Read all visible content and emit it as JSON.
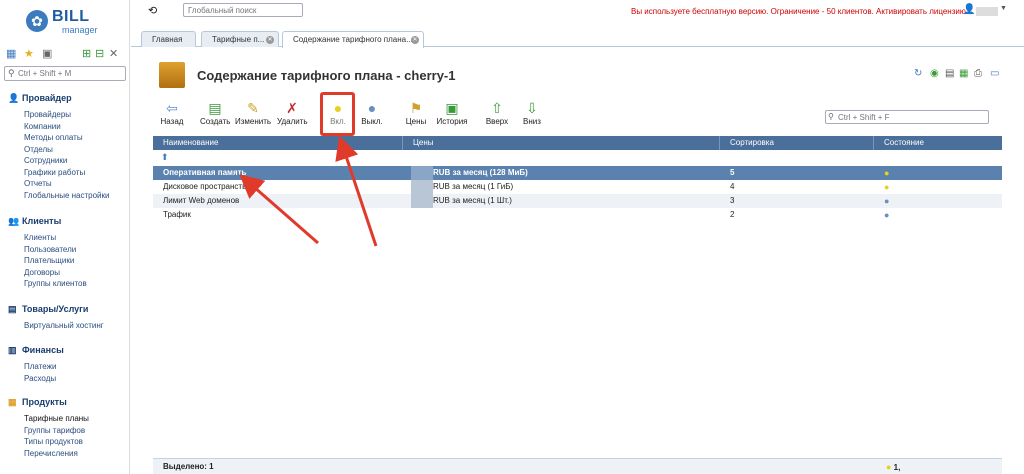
{
  "logo": {
    "name": "BILL",
    "sub": "manager"
  },
  "sidebar": {
    "search_placeholder": "Ctrl + Shift + M",
    "groups": [
      {
        "title": "Провайдер",
        "items": [
          "Провайдеры",
          "Компании",
          "Методы оплаты",
          "Отделы",
          "Сотрудники",
          "Графики работы",
          "Отчеты",
          "Глобальные настройки"
        ]
      },
      {
        "title": "Клиенты",
        "items": [
          "Клиенты",
          "Пользователи",
          "Плательщики",
          "Договоры",
          "Группы клиентов"
        ]
      },
      {
        "title": "Товары/Услуги",
        "items": [
          "Виртуальный хостинг"
        ]
      },
      {
        "title": "Финансы",
        "items": [
          "Платежи",
          "Расходы"
        ]
      },
      {
        "title": "Продукты",
        "items": [
          "Тарифные планы",
          "Группы тарифов",
          "Типы продуктов",
          "Перечисления"
        ]
      }
    ]
  },
  "topbar": {
    "search_placeholder": "Глобальный поиск",
    "notice": "Вы используете бесплатную версию. Ограничение - 50 клиентов. Активировать лицензию"
  },
  "tabs": [
    {
      "label": "Главная"
    },
    {
      "label": "Тарифные п..."
    },
    {
      "label": "Содержание тарифного плана..."
    }
  ],
  "page": {
    "title": "Содержание тарифного плана - cherry-1"
  },
  "toolbar": {
    "back": "Назад",
    "create": "Создать",
    "edit": "Изменить",
    "delete": "Удалить",
    "on": "Вкл.",
    "off": "Выкл.",
    "prices": "Цены",
    "history": "История",
    "up": "Вверх",
    "down": "Вниз"
  },
  "filter": {
    "placeholder": "Ctrl + Shift + F"
  },
  "table": {
    "columns": [
      "Наименование",
      "Цены",
      "Сортировка",
      "Состояние"
    ],
    "rows": [
      {
        "name": "Оперативная память",
        "price": "RUB за месяц (128 МиБ)",
        "sort": "5",
        "state": "on"
      },
      {
        "name": "Дисковое пространство",
        "price": "RUB за месяц (1 ГиБ)",
        "sort": "4",
        "state": "on"
      },
      {
        "name": "Лимит Web доменов",
        "price": "RUB за месяц (1 Шт.)",
        "sort": "3",
        "state": "off"
      },
      {
        "name": "Трафик",
        "price": "",
        "sort": "2",
        "state": "off"
      }
    ]
  },
  "footer": {
    "selected": "Выделено: 1",
    "summary": "1,"
  },
  "colors": {
    "accent": "#4a6f9a",
    "selected_row": "#5b82ae",
    "highlight": "#e03a2a"
  }
}
